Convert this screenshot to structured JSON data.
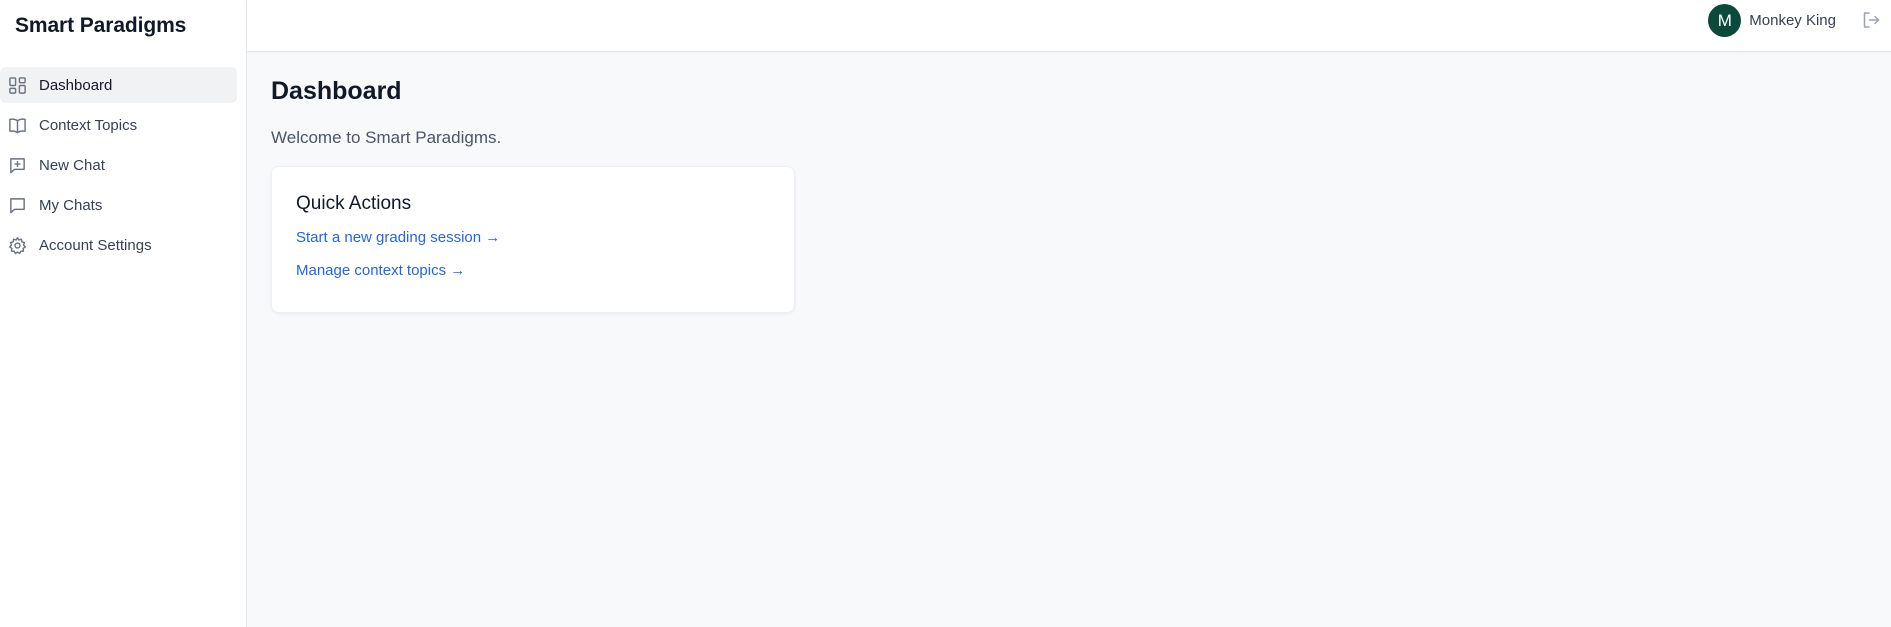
{
  "app": {
    "title": "Smart Paradigms"
  },
  "sidebar": {
    "items": [
      {
        "label": "Dashboard",
        "icon": "dashboard-icon",
        "active": true
      },
      {
        "label": "Context Topics",
        "icon": "book-icon"
      },
      {
        "label": "New Chat",
        "icon": "new-chat-icon"
      },
      {
        "label": "My Chats",
        "icon": "chat-icon"
      },
      {
        "label": "Account Settings",
        "icon": "gear-icon"
      }
    ]
  },
  "header": {
    "user": {
      "initial": "M",
      "name": "Monkey King",
      "avatar_color": "#0b4a3a"
    },
    "logout_icon": "logout-icon"
  },
  "main": {
    "title": "Dashboard",
    "welcome": "Welcome to Smart Paradigms.",
    "quick_actions": {
      "title": "Quick Actions",
      "links": [
        {
          "label": "Start a new grading session →"
        },
        {
          "label": "Manage context topics →"
        }
      ]
    }
  },
  "colors": {
    "link": "#2563eb",
    "active_nav_bg": "#f1f2f4"
  }
}
